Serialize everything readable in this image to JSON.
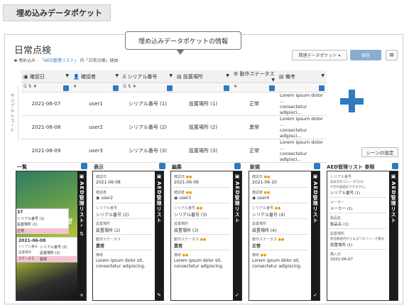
{
  "header": {
    "title": "埋め込みデータポケット"
  },
  "callout": {
    "text": "埋め込みデータポケットの情報"
  },
  "page": {
    "title": "日常点検",
    "sub_prefix": "埋め込み - ",
    "sub_link": "「AED管理リスト」",
    "sub_suffix": "内「日常点検」経由"
  },
  "toolbar": {
    "related_label": "関連データポケット ▾",
    "save_label": "保存",
    "menu_label": "≡"
  },
  "grid": {
    "sample_label": "サンプルレコード",
    "columns": [
      {
        "label": "確認日",
        "filter": "Q ⇅ ★"
      },
      {
        "label": "確認者",
        "filter": "★"
      },
      {
        "label": "シリアル番号",
        "filter": "Q ⇅ ★"
      },
      {
        "label": "設置場所",
        "filter": ""
      },
      {
        "label": "動作ステータス",
        "filter": "★"
      },
      {
        "label": "備考",
        "filter": ""
      }
    ],
    "rows": [
      {
        "date": "2021-06-07",
        "user": "user1",
        "serial": "シリアル番号 (1)",
        "place": "設置場所 (1)",
        "status": "正常",
        "note1": "Lorem ipsum dolor ...",
        "note2": "consectetur adipisci..."
      },
      {
        "date": "2021-06-08",
        "user": "user2",
        "serial": "シリアル番号 (2)",
        "place": "設置場所 (2)",
        "status": "異常",
        "note1": "Lorem ipsum dolor ...",
        "note2": "consectetur adipisci..."
      },
      {
        "date": "2021-06-09",
        "user": "user3",
        "serial": "シリアル番号 (3)",
        "place": "設置場所 (3)",
        "status": "正常",
        "note1": "Lorem ipsum dolor ...",
        "note2": "consectetur adipisci..."
      }
    ]
  },
  "scene_button": "シーンの設定",
  "panels": {
    "list": {
      "title": "一覧",
      "strip": "AED管理リスト",
      "card1": {
        "title": "37",
        "l1": "シリアル番号 (1)",
        "l2": "設置場所 (1)",
        "status": "正常"
      },
      "card2": {
        "title": "2021-06-08",
        "l1a": "シリアル番号",
        "l1b": "シリアル番号 (2)",
        "l2a": "設置場所",
        "l2b": "設置場所 (2)",
        "l3a": "ステータス",
        "l3b": "異常"
      }
    },
    "view": {
      "title": "表示",
      "strip": "AED管理リスト",
      "f1": "確認日",
      "v1": "2021-06-08",
      "f2": "確認者",
      "v2": "user2",
      "f3": "シリアル番号",
      "v3": "シリアル番号 (2)",
      "f4": "設置場所",
      "v4": "設置場所 (2)",
      "f5": "動作ステータス",
      "v5": "異常",
      "f6": "備考",
      "v6a": "Lorem ipsum dolor sit,",
      "v6b": "consectetur adipiscing."
    },
    "edit": {
      "title": "編集",
      "strip": "AED管理リスト",
      "f1": "確認日",
      "v1": "2021-06-09",
      "f2": "確認者",
      "v2": "user3",
      "f3": "シリアル番号",
      "v3": "シリアル番号 (3)",
      "f4": "設置場所",
      "v4": "設置場所 (3)",
      "f5": "動作ステータス",
      "v5": "異常",
      "f6": "備考",
      "v6a": "Lorem ipsum dolor sit,",
      "v6b": "consectetur adipiscing."
    },
    "new": {
      "title": "新規",
      "strip": "AED管理リスト",
      "f1": "確認日",
      "v1": "2021-06-10",
      "f2": "確認者",
      "v2": "user4",
      "f3": "シリアル番号",
      "v3": "シリアル番号 (4)",
      "f4": "設置場所",
      "v4": "設置場所 (4)",
      "f5": "動作ステータス",
      "v5": "正常",
      "f6": "備考",
      "v6a": "Lorem ipsum dolor sit,",
      "v6b": "consectetur adipiscing."
    },
    "ref": {
      "title": "AED管理リスト 参照",
      "strip": "AED管理リスト",
      "f1": "シリアル番号",
      "v1a": "非表示のコニーグ(5)の",
      "v1b": "※元の画面はできません。",
      "v1c": "シリアル番号 (1)",
      "f2": "メーカー",
      "v2": "メーカー (1)",
      "f3": "製品名",
      "v3": "製品名 (1)",
      "f4": "設置場所",
      "v4a": "製品機能内からまよりなリシーズ番号",
      "v4b": "設置場所 (1)",
      "f5": "購入日",
      "v5": "2021-06-07"
    }
  }
}
